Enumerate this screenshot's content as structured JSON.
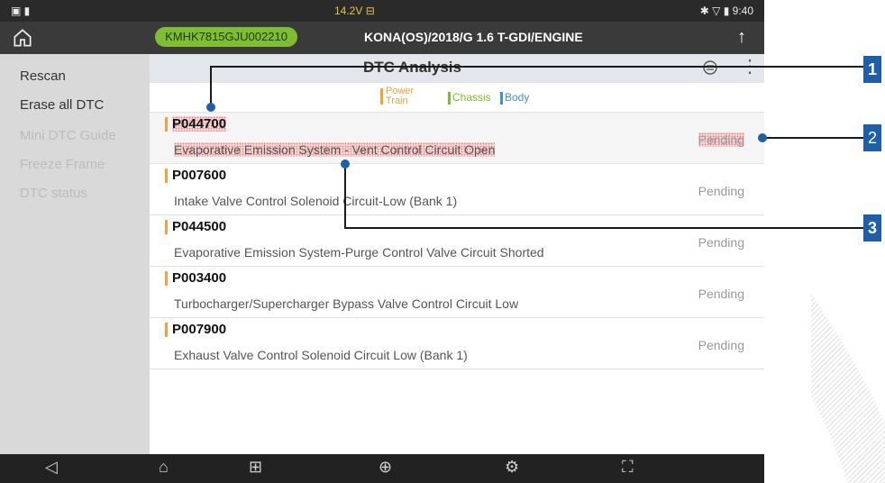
{
  "statusbar": {
    "left_icons": "▣ ▮",
    "voltage": "14.2V ⊟",
    "right": "✱ ▽ ▮ 9:40"
  },
  "appbar": {
    "vin": "KMHK7815GJU002210",
    "vehicle": "KONA(OS)/2018/G 1.6 T-GDI/ENGINE"
  },
  "sidebar": {
    "items": [
      {
        "label": "Rescan",
        "enabled": true
      },
      {
        "label": "Erase all DTC",
        "enabled": true
      },
      {
        "label": "Mini DTC Guide",
        "enabled": false
      },
      {
        "label": "Freeze Frame",
        "enabled": false
      },
      {
        "label": "DTC status",
        "enabled": false
      }
    ]
  },
  "main": {
    "title": "DTC Analysis",
    "legend": {
      "power_train_line1": "Power",
      "power_train_line2": "Train",
      "chassis": "Chassis",
      "body": "Body"
    },
    "rows": [
      {
        "code": "P044700",
        "desc": "Evaporative Emission System - Vent Control Circuit Open",
        "status": "Pending"
      },
      {
        "code": "P007600",
        "desc": "Intake Valve Control Solenoid Circuit-Low (Bank 1)",
        "status": "Pending"
      },
      {
        "code": "P044500",
        "desc": "Evaporative Emission System-Purge Control Valve Circuit Shorted",
        "status": "Pending"
      },
      {
        "code": "P003400",
        "desc": "Turbocharger/Supercharger Bypass Valve Control Circuit Low",
        "status": "Pending"
      },
      {
        "code": "P007900",
        "desc": "Exhaust Valve Control Solenoid Circuit Low (Bank 1)",
        "status": "Pending"
      }
    ]
  },
  "callouts": [
    "1",
    "2",
    "3"
  ],
  "colors": {
    "vin_badge": "#7fbf2f",
    "power_train": "#f2a23a",
    "chassis": "#7cbf28",
    "body": "#3a95d8",
    "callout": "#1d5fa8"
  }
}
